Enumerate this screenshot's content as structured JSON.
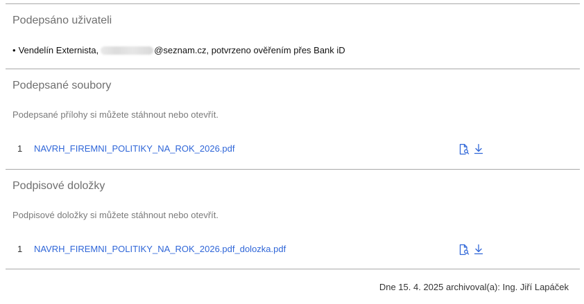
{
  "signed_by": {
    "title": "Podepsáno uživateli",
    "signers": [
      {
        "bullet": "•",
        "name_prefix": "Vendelín Externista,",
        "email_suffix": "@seznam.cz, potvrzeno ověřením přes Bank iD"
      }
    ]
  },
  "signed_files": {
    "title": "Podepsané soubory",
    "description": "Podepsané přílohy si můžete stáhnout nebo otevřít.",
    "files": [
      {
        "index": "1",
        "name": "NAVRH_FIREMNI_POLITIKY_NA_ROK_2026.pdf",
        "icons": [
          "document-search-icon",
          "download-icon"
        ]
      }
    ]
  },
  "signature_clauses": {
    "title": "Podpisové doložky",
    "description": "Podpisové doložky si můžete stáhnout nebo otevřít.",
    "files": [
      {
        "index": "1",
        "name": "NAVRH_FIREMNI_POLITIKY_NA_ROK_2026.pdf_dolozka.pdf",
        "icons": [
          "document-search-icon",
          "download-icon"
        ]
      }
    ]
  },
  "footer": {
    "archived_text": "Dne 15. 4. 2025 archivoval(a): Ing. Jiří Lapáček"
  },
  "colors": {
    "link": "#2f66d8",
    "muted_text": "#6f6f6f",
    "divider": "#a8a8a8"
  }
}
